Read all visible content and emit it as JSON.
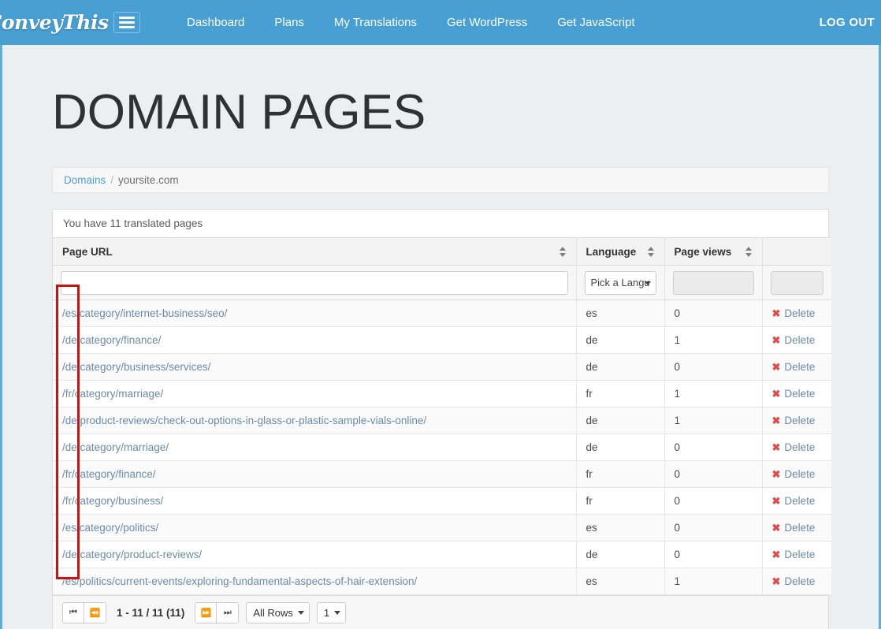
{
  "navbar": {
    "brand": "ConveyThis",
    "menu_icon": "hamburger-icon",
    "links": [
      {
        "label": "Dashboard"
      },
      {
        "label": "Plans"
      },
      {
        "label": "My Translations"
      },
      {
        "label": "Get WordPress"
      },
      {
        "label": "Get JavaScript"
      }
    ],
    "logout": "LOG OUT",
    "background_color": "#479fd3"
  },
  "page": {
    "title": "DOMAIN PAGES",
    "breadcrumb": {
      "root": "Domains",
      "separator": "/",
      "current": "yoursite.com"
    },
    "summary": "You have 11 translated pages"
  },
  "table": {
    "columns": [
      {
        "label": "Page URL",
        "sortable": true
      },
      {
        "label": "Language",
        "sortable": true
      },
      {
        "label": "Page views",
        "sortable": true
      },
      {
        "label": "",
        "sortable": false
      }
    ],
    "filters": {
      "url_value": "",
      "url_placeholder": "",
      "language_value": "Pick a Langu",
      "page_views_value": "",
      "actions_value": ""
    },
    "delete_label": "Delete",
    "delete_icon": "x-mark-icon",
    "rows": [
      {
        "url": "/es/category/internet-business/seo/",
        "language": "es",
        "views": "0"
      },
      {
        "url": "/de/category/finance/",
        "language": "de",
        "views": "1"
      },
      {
        "url": "/de/category/business/services/",
        "language": "de",
        "views": "0"
      },
      {
        "url": "/fr/category/marriage/",
        "language": "fr",
        "views": "1"
      },
      {
        "url": "/de/product-reviews/check-out-options-in-glass-or-plastic-sample-vials-online/",
        "language": "de",
        "views": "1"
      },
      {
        "url": "/de/category/marriage/",
        "language": "de",
        "views": "0"
      },
      {
        "url": "/fr/category/finance/",
        "language": "fr",
        "views": "0"
      },
      {
        "url": "/fr/category/business/",
        "language": "fr",
        "views": "0"
      },
      {
        "url": "/es/category/politics/",
        "language": "es",
        "views": "0"
      },
      {
        "url": "/de/category/product-reviews/",
        "language": "de",
        "views": "0"
      },
      {
        "url": "/es/politics/current-events/exploring-fundamental-aspects-of-hair-extension/",
        "language": "es",
        "views": "1"
      }
    ]
  },
  "pagination": {
    "first_icon": "⏮",
    "prev_icon": "⏪",
    "next_icon": "⏩",
    "last_icon": "⏭",
    "range": "1 - 11 / 11 (11)",
    "rows_per_page": "All Rows",
    "page_number": "1"
  },
  "annotation": {
    "color": "#cc1111",
    "shape": "rectangle-highlight"
  }
}
